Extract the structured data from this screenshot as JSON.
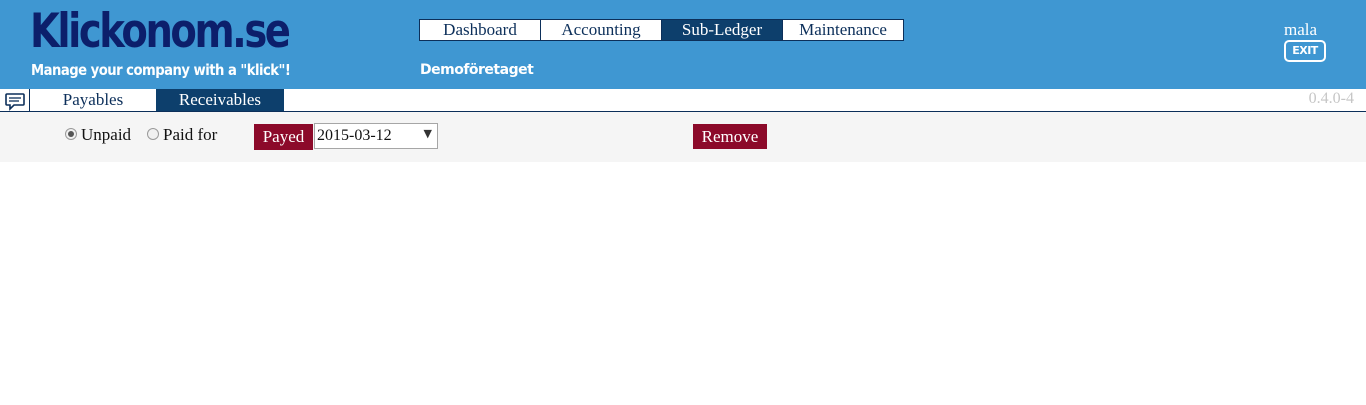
{
  "brand": {
    "title": "Klickonom.se",
    "tagline": "Manage your company with a \"klick\"!"
  },
  "main_nav": {
    "tabs": [
      {
        "label": "Dashboard",
        "active": false
      },
      {
        "label": "Accounting",
        "active": false
      },
      {
        "label": "Sub-Ledger",
        "active": true
      },
      {
        "label": "Maintenance",
        "active": false
      }
    ]
  },
  "company": "Demoföretaget",
  "user": {
    "name": "mala",
    "exit_label": "EXIT"
  },
  "sub_nav": {
    "tabs": [
      {
        "label": "Payables",
        "active": false
      },
      {
        "label": "Receivables",
        "active": true
      }
    ],
    "chat_icon": "chat-bubble-icon",
    "version": "0.4.0-4"
  },
  "filters": {
    "unpaid_label": "Unpaid",
    "unpaid_checked": true,
    "paid_label": "Paid for",
    "paid_checked": false,
    "payed_label": "Payed",
    "date_value": "2015-03-12",
    "remove_label": "Remove"
  },
  "colors": {
    "header_bg": "#3f97d2",
    "brand_text": "#0c1f6b",
    "active_tab": "#0d3f6c",
    "action_button": "#8c0a2a",
    "filter_bar_bg": "#f5f5f5"
  }
}
